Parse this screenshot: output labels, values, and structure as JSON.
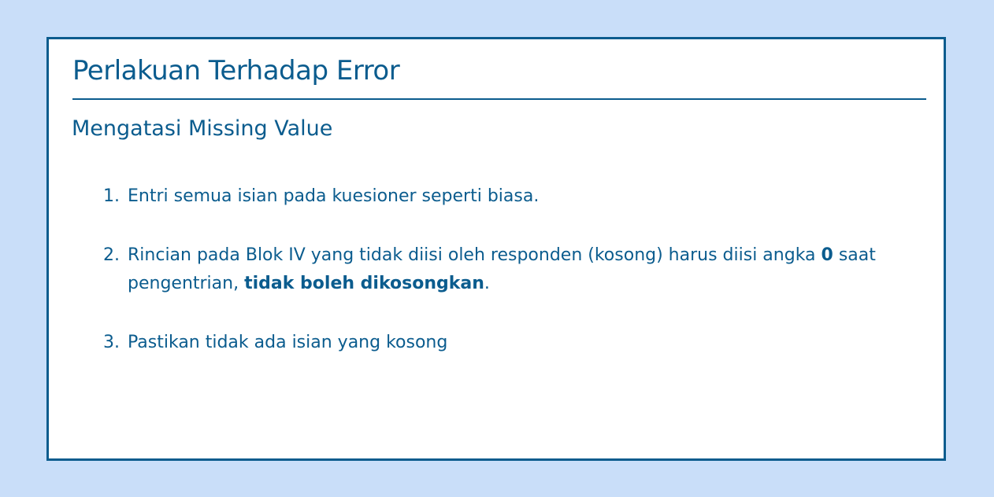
{
  "slide": {
    "title": "Perlakuan Terhadap Error",
    "subtitle": "Mengatasi Missing Value",
    "steps": [
      {
        "num": "1.",
        "text": "Entri semua isian pada kuesioner seperti biasa."
      },
      {
        "num": "2.",
        "text_a": "Rincian pada Blok IV yang tidak diisi oleh responden (kosong) harus diisi angka ",
        "bold_a": "0",
        "text_b": " saat pengentrian, ",
        "bold_b": "tidak boleh dikosongkan",
        "text_c": "."
      },
      {
        "num": "3.",
        "text": "Pastikan tidak ada isian yang kosong"
      }
    ]
  },
  "colors": {
    "background": "#c9def9",
    "accent": "#0b5c8e",
    "card": "#ffffff"
  }
}
